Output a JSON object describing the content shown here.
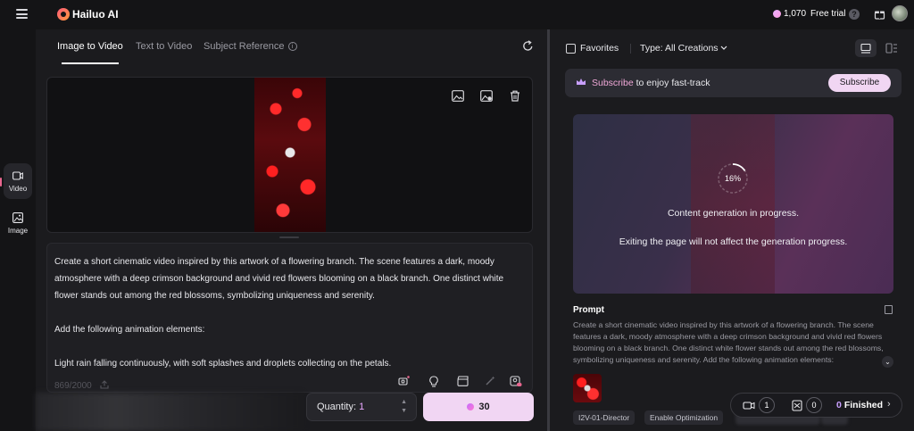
{
  "brand": {
    "name": "Hailuo AI"
  },
  "header": {
    "credits": "1,070",
    "trial_label": "Free trial",
    "help_glyph": "?"
  },
  "sidebar": {
    "items": [
      {
        "label": "Video",
        "icon": "video-icon"
      },
      {
        "label": "Image",
        "icon": "image-icon"
      }
    ]
  },
  "tabs": [
    {
      "label": "Image to Video",
      "active": true
    },
    {
      "label": "Text to Video"
    },
    {
      "label": "Subject Reference"
    }
  ],
  "prompt": {
    "text": "Create a short cinematic video inspired by this artwork of a flowering branch. The scene features a dark, moody atmosphere with a deep crimson background and vivid red flowers blooming on a black branch. One distinct white flower stands out among the red blossoms, symbolizing uniqueness and serenity.\n\nAdd the following animation elements:\n\nLight rain falling continuously, with soft splashes and droplets collecting on the petals.",
    "char_count": "869/2000"
  },
  "generate": {
    "quantity_label": "Quantity:",
    "quantity_value": "1",
    "cost": "30"
  },
  "gallery": {
    "favorites_label": "Favorites",
    "type_label": "Type:",
    "type_value": "All Creations",
    "banner": {
      "highlight": "Subscribe",
      "rest": " to enjoy fast-track",
      "button": "Subscribe"
    },
    "progress": {
      "percent": "16%",
      "fraction": 0.16,
      "message": "Content generation in progress.",
      "note": "Exiting the page will not affect the generation progress."
    },
    "prompt_heading": "Prompt",
    "prompt_preview": "Create a short cinematic video inspired by this artwork of a flowering branch. The scene features a dark, moody atmosphere with a deep crimson background and vivid red flowers blooming on a black branch. One distinct white flower stands out among the red blossoms, symbolizing uniqueness and serenity. Add the following animation elements:",
    "chips": [
      "I2V-01-Director",
      "Enable Optimization"
    ]
  },
  "status": {
    "queued": "1",
    "waiting": "0",
    "finished_count": "0",
    "finished_label": "Finished"
  },
  "colors": {
    "accent": "#f1d6f3",
    "bg": "#141416",
    "panel": "#1b1b1e",
    "highlight": "#f0a8d8"
  }
}
